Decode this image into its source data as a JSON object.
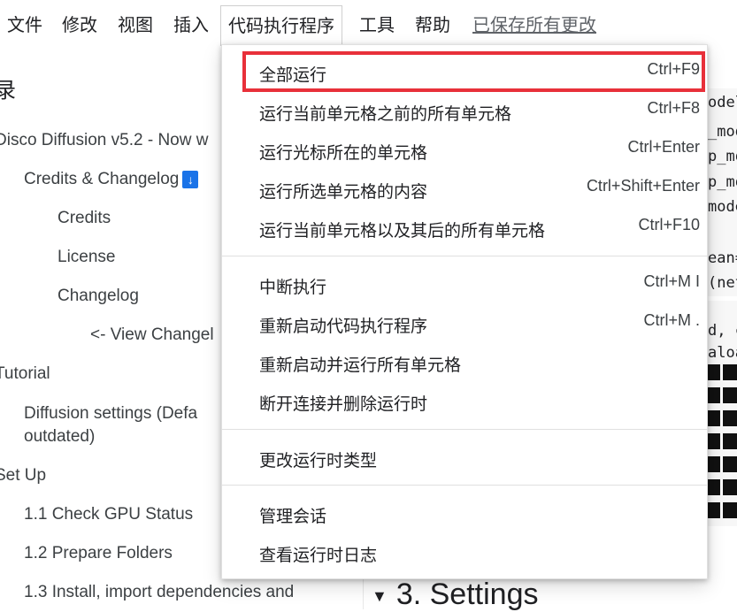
{
  "menubar": {
    "items": [
      "文件",
      "修改",
      "视图",
      "插入",
      "代码执行程序",
      "工具",
      "帮助"
    ],
    "saved_label": "已保存所有更改"
  },
  "toc": {
    "title": "录",
    "items": [
      "Disco Diffusion v5.2 - Now w",
      "Credits & Changelog",
      "Credits",
      "License",
      "Changelog",
      "<- View Changel",
      "Tutorial",
      "Diffusion settings (Defa",
      "outdated)",
      "Set Up",
      "1.1 Check GPU Status",
      "1.2 Prepare Folders",
      "1.3 Install, import dependencies and"
    ],
    "badge": "↓"
  },
  "code": {
    "lines": [
      "odel",
      "_mod",
      "p_mo",
      "p_mo",
      "mode",
      "ean=",
      "(net",
      "d, c",
      "aloa"
    ]
  },
  "settings_heading": "3. Settings",
  "runtime_menu": {
    "items": [
      {
        "label": "全部运行",
        "shortcut": "Ctrl+F9"
      },
      {
        "label": "运行当前单元格之前的所有单元格",
        "shortcut": "Ctrl+F8"
      },
      {
        "label": "运行光标所在的单元格",
        "shortcut": "Ctrl+Enter"
      },
      {
        "label": "运行所选单元格的内容",
        "shortcut": "Ctrl+Shift+Enter"
      },
      {
        "label": "运行当前单元格以及其后的所有单元格",
        "shortcut": "Ctrl+F10"
      },
      {
        "label": "中断执行",
        "shortcut": "Ctrl+M I"
      },
      {
        "label": "重新启动代码执行程序",
        "shortcut": "Ctrl+M ."
      },
      {
        "label": "重新启动并运行所有单元格",
        "shortcut": ""
      },
      {
        "label": "断开连接并删除运行时",
        "shortcut": ""
      },
      {
        "label": "更改运行时类型",
        "shortcut": ""
      },
      {
        "label": "管理会话",
        "shortcut": ""
      },
      {
        "label": "查看运行时日志",
        "shortcut": ""
      }
    ],
    "highlight_color": "#e8303a"
  }
}
